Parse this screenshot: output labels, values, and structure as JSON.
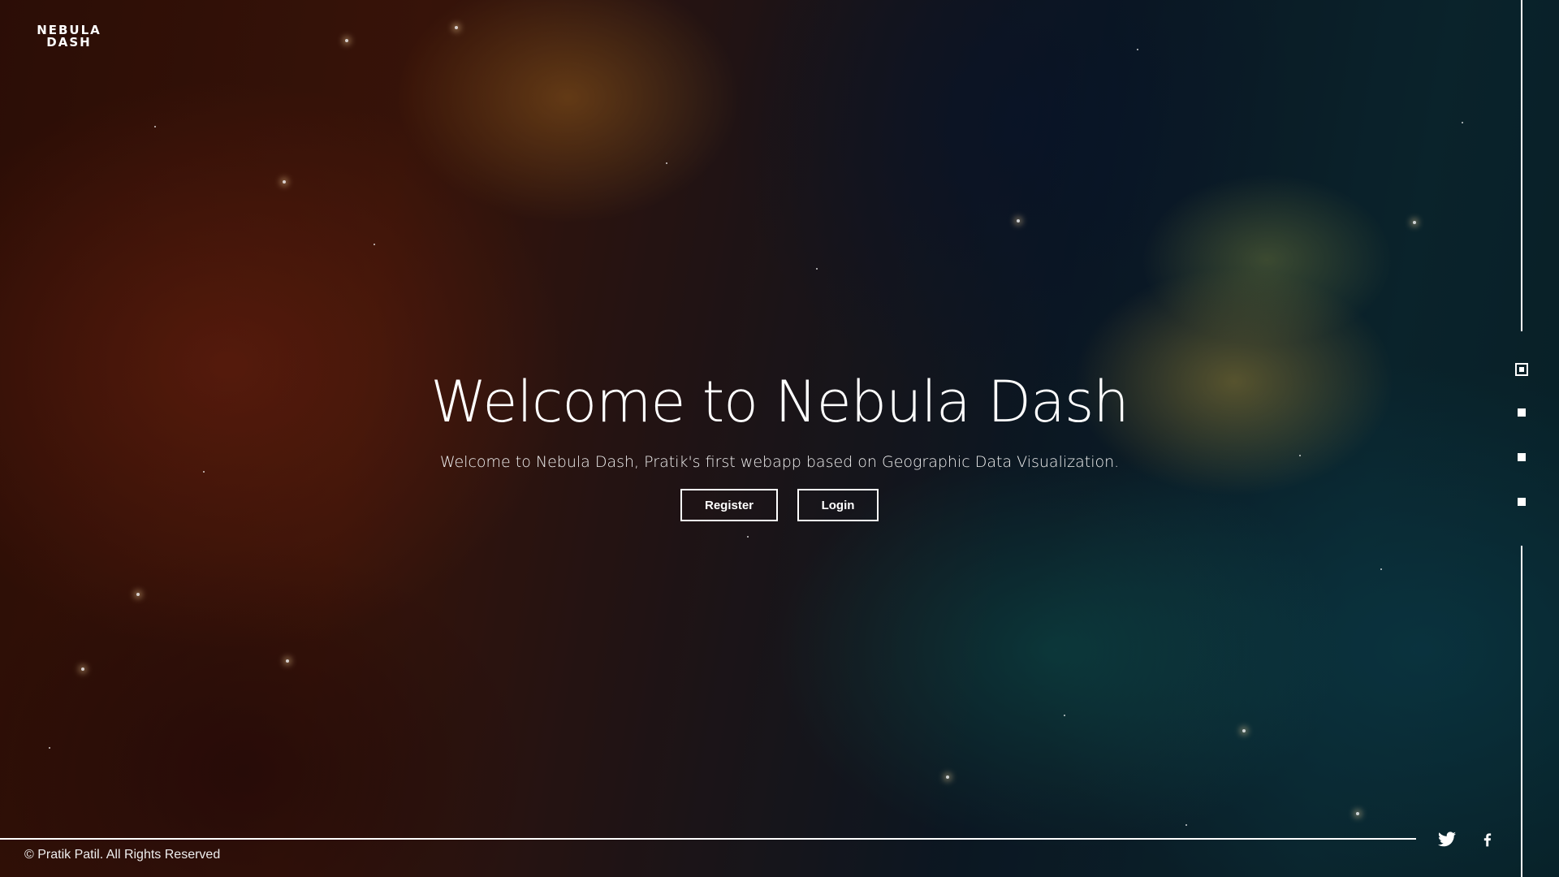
{
  "brand": {
    "logo_line1": "NEBULA",
    "logo_line2": "DASH"
  },
  "hero": {
    "title": "Welcome to Nebula Dash",
    "subtitle": "Welcome to Nebula Dash, Pratik's first webapp based on Geographic Data Visualization.",
    "register_label": "Register",
    "login_label": "Login"
  },
  "section_nav": {
    "count": 4,
    "active_index": 0
  },
  "footer": {
    "copyright": "© Pratik Patil. All Rights Reserved",
    "social": [
      "twitter-icon",
      "facebook-icon"
    ]
  },
  "colors": {
    "text": "#ffffff",
    "accent": "#ffffff"
  }
}
